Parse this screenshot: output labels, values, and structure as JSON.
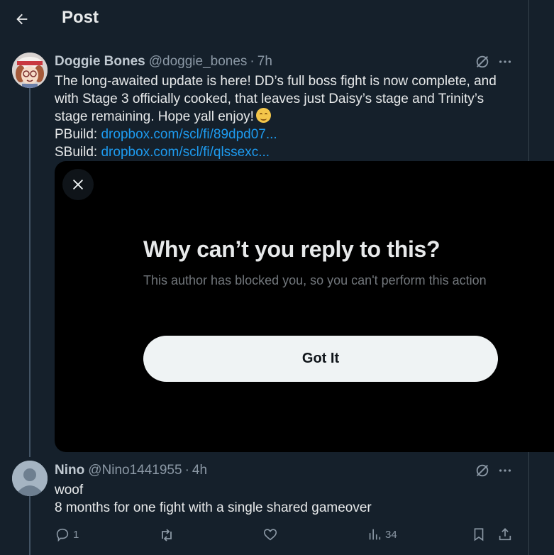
{
  "header": {
    "title": "Post"
  },
  "post": {
    "author_name": "Doggie Bones",
    "author_handle": "@doggie_bones",
    "separator": "·",
    "time": "7h",
    "text": "The long-awaited update is here! DD’s full boss fight is now complete,  and with Stage 3 officially cooked, that leaves just Daisy’s stage and  Trinity’s stage remaining. Hope yall enjoy!",
    "pbuild_label": "PBuild:",
    "pbuild_link": "dropbox.com/scl/fi/89dpd07...",
    "sbuild_label": "SBuild:",
    "sbuild_link": "dropbox.com/scl/fi/qlssexc..."
  },
  "modal": {
    "title": "Why can’t you reply to this?",
    "body": "This author has blocked you, so you can't perform this action",
    "button_label": "Got It"
  },
  "reply": {
    "author_name": "Nino",
    "author_handle": "@Nino1441955",
    "separator": "·",
    "time": "4h",
    "line1": "woof",
    "line2": "8 months for one fight with a single shared gameover",
    "actions": {
      "reply_count": "1",
      "repost_count": "",
      "like_count": "",
      "views_count": "34"
    }
  },
  "colors": {
    "background": "#15202b",
    "link": "#1d9bf0",
    "modal_background": "#000000",
    "button_background": "#eff3f4"
  }
}
